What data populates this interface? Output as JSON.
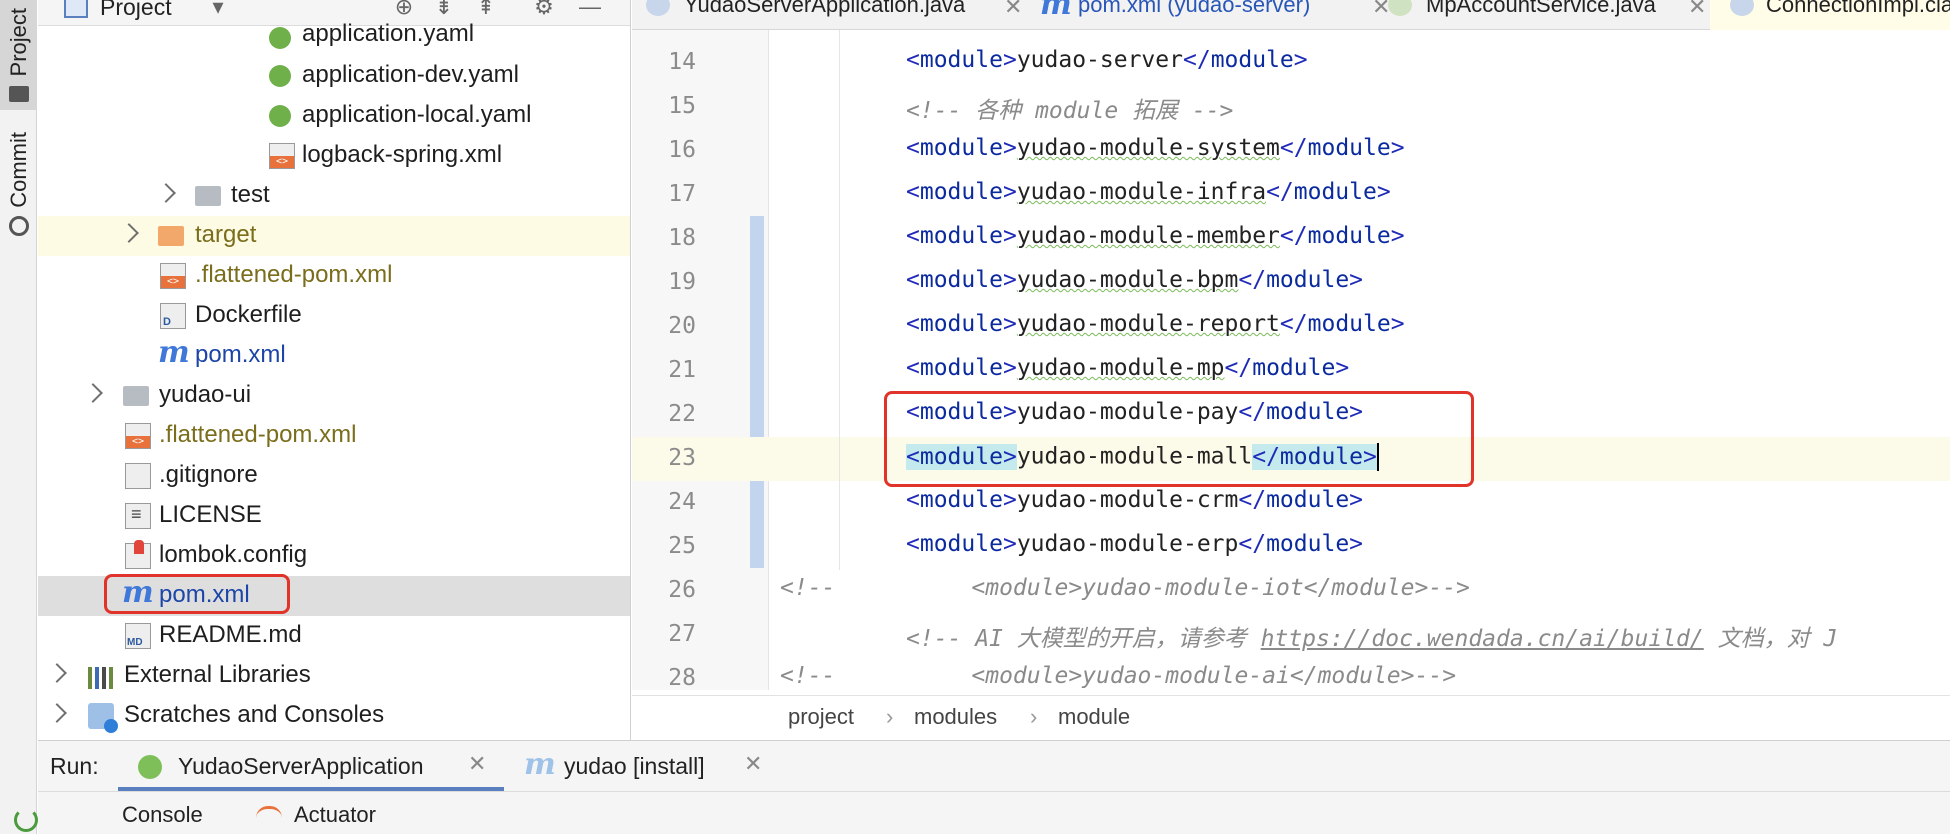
{
  "tool_strip": {
    "project_label": "Project",
    "commit_label": "Commit"
  },
  "project_panel": {
    "title": "Project",
    "tree": [
      {
        "label": "application.yaml"
      },
      {
        "label": "application-dev.yaml"
      },
      {
        "label": "application-local.yaml"
      },
      {
        "label": "logback-spring.xml"
      },
      {
        "label": "test"
      },
      {
        "label": "target"
      },
      {
        "label": ".flattened-pom.xml"
      },
      {
        "label": "Dockerfile"
      },
      {
        "label": "pom.xml"
      },
      {
        "label": "yudao-ui"
      },
      {
        "label": ".flattened-pom.xml"
      },
      {
        "label": ".gitignore"
      },
      {
        "label": "LICENSE"
      },
      {
        "label": "lombok.config"
      },
      {
        "label": "pom.xml"
      },
      {
        "label": "README.md"
      },
      {
        "label": "External Libraries"
      },
      {
        "label": "Scratches and Consoles"
      }
    ]
  },
  "editor": {
    "tabs": [
      {
        "label": "YudaoServerApplication.java"
      },
      {
        "label": "pom.xml (yudao-server)"
      },
      {
        "label": "MpAccountService.java"
      },
      {
        "label": "ConnectionImpl.cla"
      }
    ],
    "lines": [
      {
        "num": "14",
        "tag": "module",
        "value": "yudao-server"
      },
      {
        "num": "15",
        "comment": "<!-- 各种 module 拓展 -->"
      },
      {
        "num": "16",
        "tag": "module",
        "value": "yudao-module-system"
      },
      {
        "num": "17",
        "tag": "module",
        "value": "yudao-module-infra"
      },
      {
        "num": "18",
        "tag": "module",
        "value": "yudao-module-member"
      },
      {
        "num": "19",
        "tag": "module",
        "value": "yudao-module-bpm"
      },
      {
        "num": "20",
        "tag": "module",
        "value": "yudao-module-report"
      },
      {
        "num": "21",
        "tag": "module",
        "value": "yudao-module-mp"
      },
      {
        "num": "22",
        "tag": "module",
        "value": "yudao-module-pay"
      },
      {
        "num": "23",
        "tag": "module",
        "value": "yudao-module-mall"
      },
      {
        "num": "24",
        "tag": "module",
        "value": "yudao-module-crm"
      },
      {
        "num": "25",
        "tag": "module",
        "value": "yudao-module-erp"
      },
      {
        "num": "26",
        "comment_open": "<!--",
        "commented": "<module>yudao-module-iot</module>-->"
      },
      {
        "num": "27",
        "comment_pre": "<!-- AI 大模型的开启，请参考 ",
        "link": "https://doc.wendada.cn/ai/build/",
        "comment_post": " 文档，对 J"
      },
      {
        "num": "28",
        "comment_open": "<!--",
        "commented": "<module>yudao-module-ai</module>-->"
      }
    ],
    "breadcrumb": [
      "project",
      "modules",
      "module"
    ]
  },
  "run_panel": {
    "label": "Run:",
    "tabs": [
      {
        "label": "YudaoServerApplication"
      },
      {
        "label": "yudao [install]"
      }
    ],
    "subtabs": [
      {
        "label": "Console"
      },
      {
        "label": "Actuator"
      }
    ]
  },
  "icons": {
    "yaml": "spring-yaml-icon",
    "xml": "xml-file-icon",
    "maven": "maven-m-icon",
    "folder": "folder-icon"
  }
}
